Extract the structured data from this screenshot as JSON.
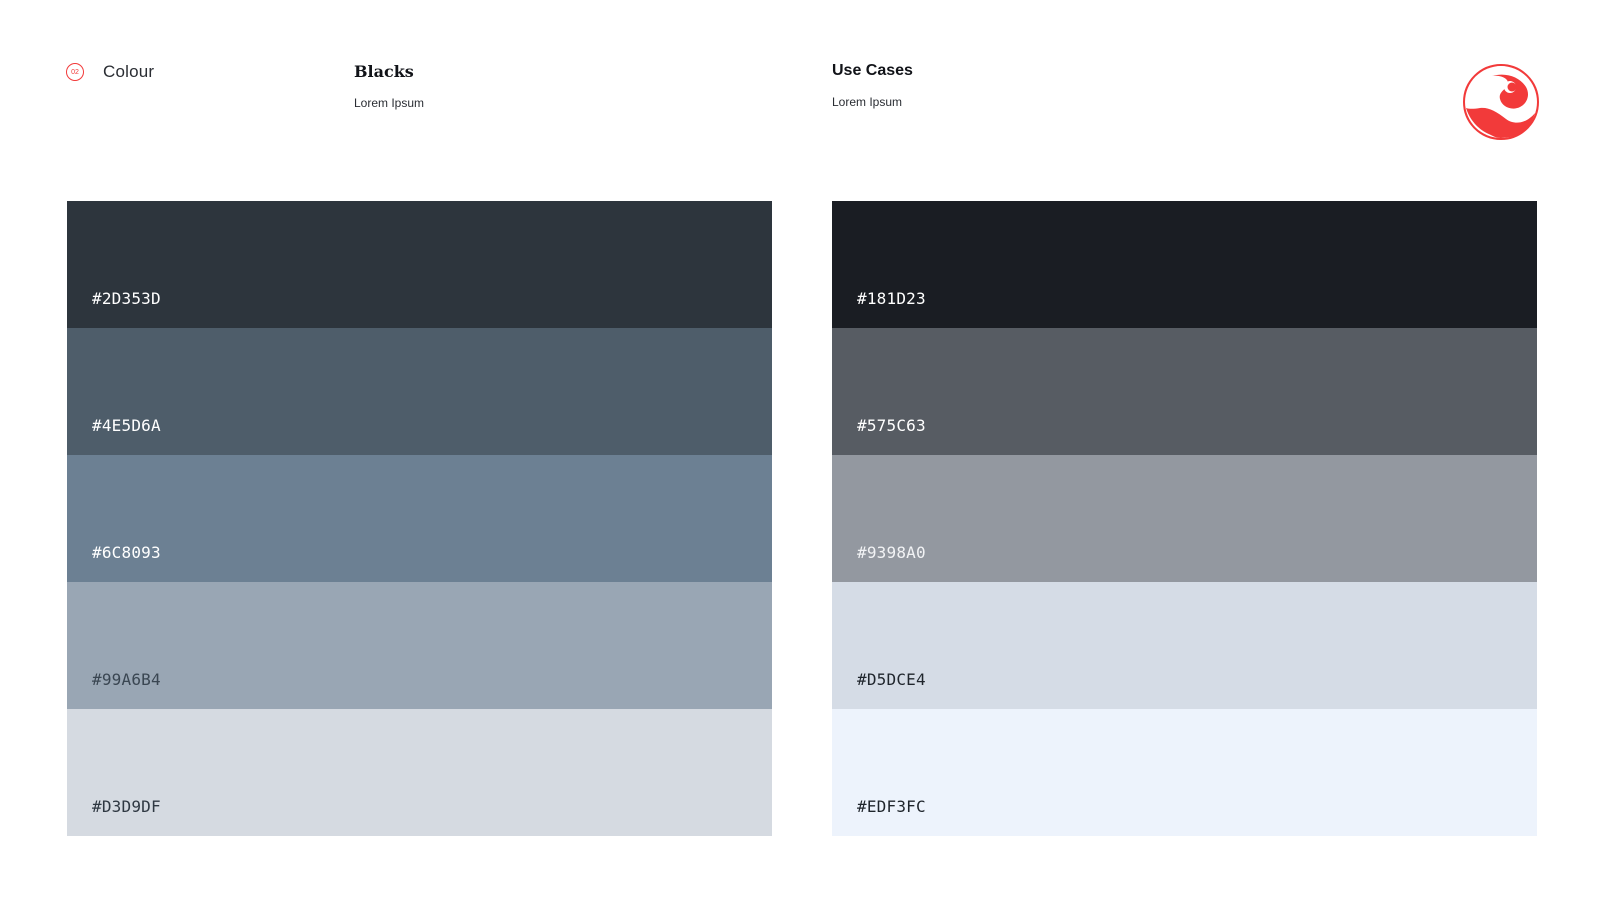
{
  "section": {
    "number": "02",
    "label": "Colour"
  },
  "blacks": {
    "title": "Blacks",
    "subtitle": "Lorem Ipsum",
    "swatches": [
      {
        "code": "#2D353D",
        "color": "#2d353d",
        "text_color": "#ffffff"
      },
      {
        "code": "#4E5D6A",
        "color": "#4e5d6a",
        "text_color": "#ffffff"
      },
      {
        "code": "#6C8093",
        "color": "#6c8093",
        "text_color": "#ffffff"
      },
      {
        "code": "#99A6B4",
        "color": "#99a6b4",
        "text_color": "#3a4652"
      },
      {
        "code": "#D3D9DF",
        "color": "#d5dae1",
        "text_color": "#2f3842"
      }
    ]
  },
  "use_cases": {
    "title": "Use Cases",
    "subtitle": "Lorem Ipsum",
    "swatches": [
      {
        "code": "#181D23",
        "color": "#1a1d23",
        "text_color": "#ffffff"
      },
      {
        "code": "#575C63",
        "color": "#575c63",
        "text_color": "#ffffff"
      },
      {
        "code": "#9398A0",
        "color": "#9398a0",
        "text_color": "#f2f3f5"
      },
      {
        "code": "#D5DCE4",
        "color": "#d5dce6",
        "text_color": "#1f252c"
      },
      {
        "code": "#EDF3FC",
        "color": "#edf3fc",
        "text_color": "#1f252c"
      }
    ]
  },
  "logo": {
    "icon": "yin-yang-icon",
    "color": "#f23a3a"
  }
}
